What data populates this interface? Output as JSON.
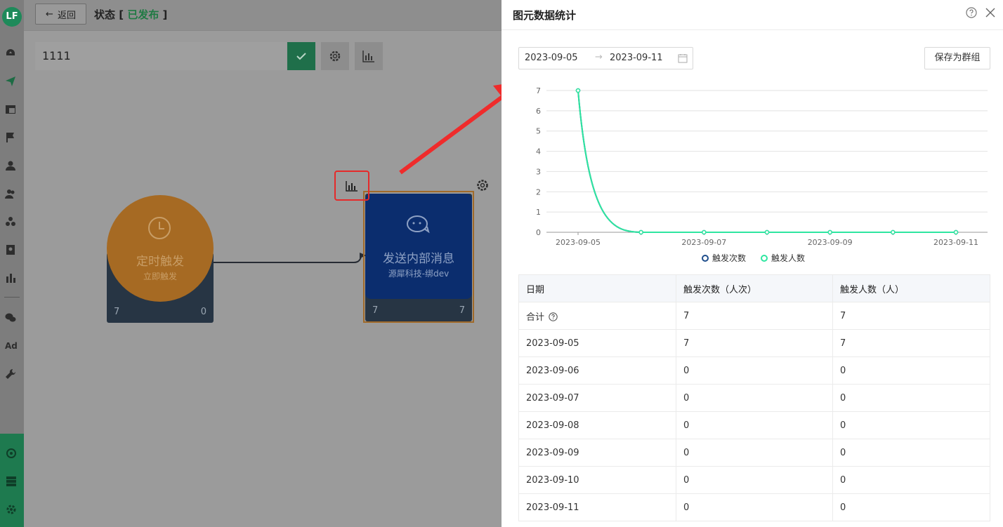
{
  "nav": {
    "logo": "LF",
    "items": [
      "dashboard-icon",
      "send-icon",
      "layout-icon",
      "flag-icon",
      "user-icon",
      "users-icon",
      "group-icon",
      "contact-icon",
      "bar-chart-icon",
      "wechat-icon",
      "ad-icon",
      "wrench-icon"
    ],
    "ad_label": "Ad",
    "bottom_items": [
      "audience-icon",
      "server-icon",
      "settings-icon"
    ]
  },
  "header": {
    "back_label": "返回",
    "status_prefix": "状态 [ ",
    "status_value": "已发布",
    "status_suffix": " ]"
  },
  "toolbar": {
    "name_value": "1111"
  },
  "flow": {
    "timer_node": {
      "title": "定时触发",
      "subtitle": "立即触发",
      "count_left": "7",
      "count_right": "0"
    },
    "message_node": {
      "title": "发送内部消息",
      "subtitle": "源犀科技-绑dev",
      "count_left": "7",
      "count_right": "7"
    }
  },
  "drawer": {
    "title": "图元数据统计",
    "date_start": "2023-09-05",
    "date_sep": "→",
    "date_end": "2023-09-11",
    "save_group_label": "保存为群组"
  },
  "chart_data": {
    "type": "line",
    "x": [
      "2023-09-05",
      "2023-09-06",
      "2023-09-07",
      "2023-09-08",
      "2023-09-09",
      "2023-09-10",
      "2023-09-11"
    ],
    "x_tick_labels": [
      "2023-09-05",
      "2023-09-07",
      "2023-09-09",
      "2023-09-11"
    ],
    "series": [
      {
        "name": "触发次数",
        "values": [
          7,
          0,
          0,
          0,
          0,
          0,
          0
        ],
        "color": "#1f4e8c"
      },
      {
        "name": "触发人数",
        "values": [
          7,
          0,
          0,
          0,
          0,
          0,
          0
        ],
        "color": "#2ee6a0"
      }
    ],
    "ylim": [
      0,
      7
    ],
    "yticks": [
      0,
      1,
      2,
      3,
      4,
      5,
      6,
      7
    ],
    "grid": true,
    "legend": "bottom"
  },
  "table": {
    "headers": [
      "日期",
      "触发次数（人次）",
      "触发人数（人）"
    ],
    "total_label": "合计",
    "total": [
      "7",
      "7"
    ],
    "rows": [
      [
        "2023-09-05",
        "7",
        "7"
      ],
      [
        "2023-09-06",
        "0",
        "0"
      ],
      [
        "2023-09-07",
        "0",
        "0"
      ],
      [
        "2023-09-08",
        "0",
        "0"
      ],
      [
        "2023-09-09",
        "0",
        "0"
      ],
      [
        "2023-09-10",
        "0",
        "0"
      ],
      [
        "2023-09-11",
        "0",
        "0"
      ]
    ]
  }
}
